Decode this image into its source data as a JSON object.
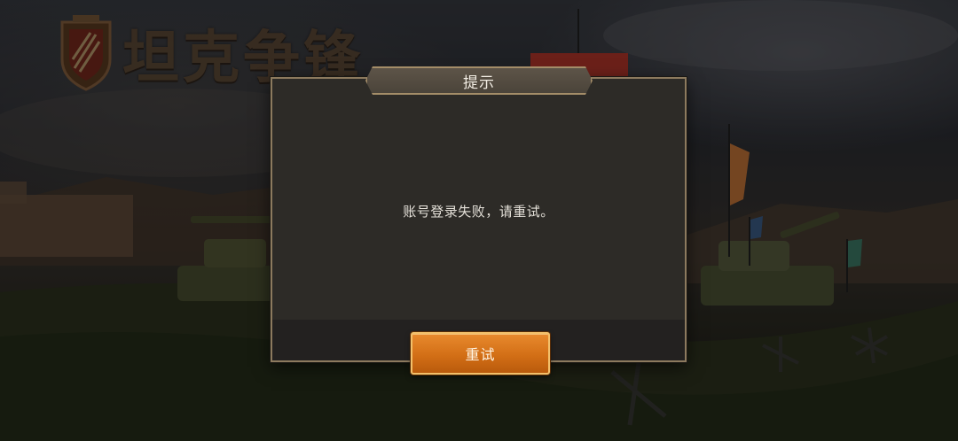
{
  "game": {
    "logo_text": "坦克争锋"
  },
  "dialog": {
    "title": "提示",
    "message": "账号登录失败，请重试。",
    "retry_label": "重试"
  },
  "colors": {
    "dialog_bg": "#2d2b27",
    "dialog_border": "#8c7a5e",
    "button_orange": "#d36f16",
    "logo_brown": "#6b5034"
  }
}
